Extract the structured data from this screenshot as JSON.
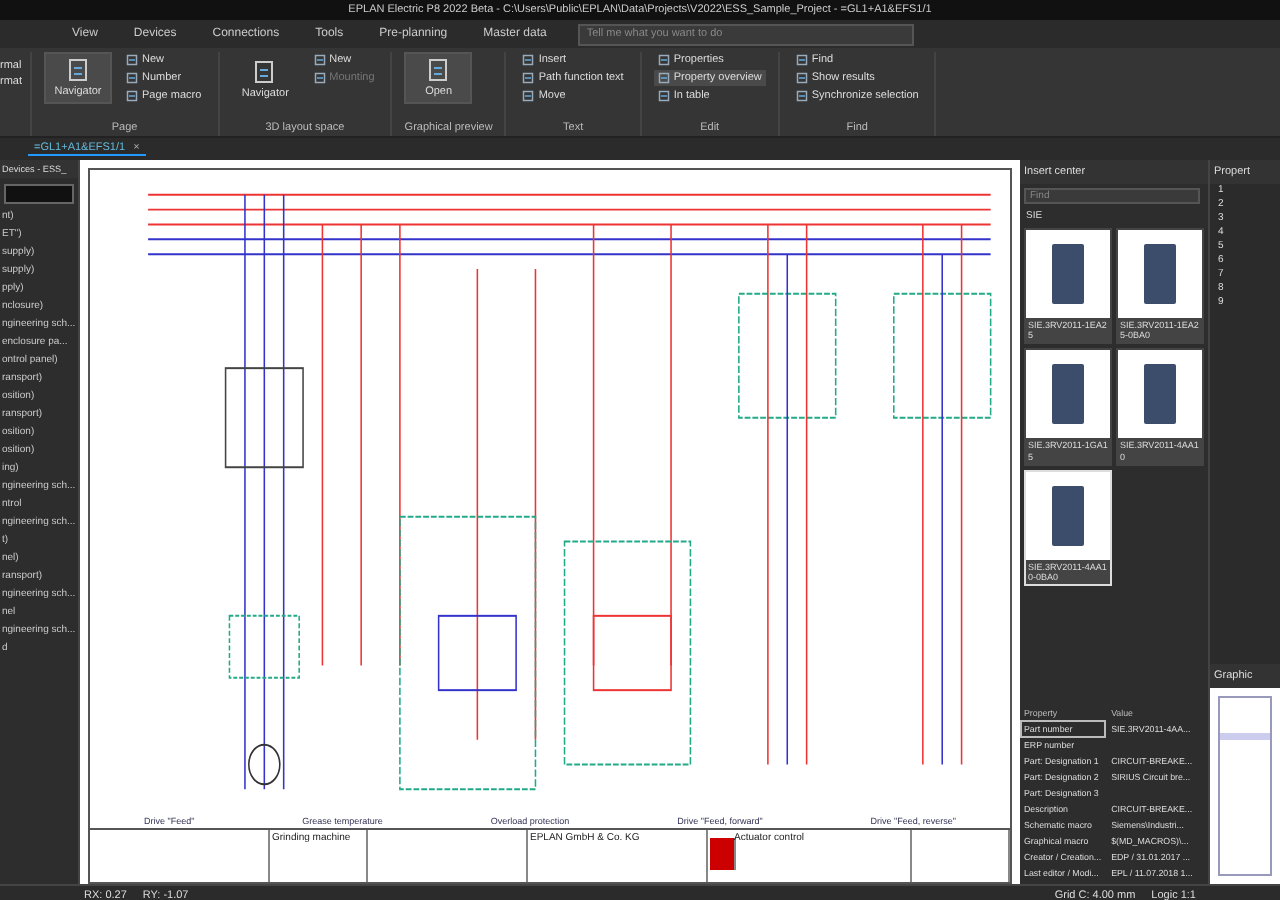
{
  "window": {
    "title": "EPLAN Electric P8 2022 Beta - C:\\Users\\Public\\EPLAN\\Data\\Projects\\V2022\\ESS_Sample_Project - =GL1+A1&EFS1/1"
  },
  "menu": [
    {
      "label": "View",
      "selected": false
    },
    {
      "label": "Devices",
      "selected": false
    },
    {
      "label": "Connections",
      "selected": false
    },
    {
      "label": "Tools",
      "selected": false
    },
    {
      "label": "Pre-planning",
      "selected": false
    },
    {
      "label": "Master data",
      "selected": false
    }
  ],
  "search": {
    "placeholder": "Tell me what you want to do"
  },
  "ribbon": {
    "cut_items": [
      "rmal",
      "rmat"
    ],
    "groups": [
      {
        "label": "Page",
        "large": {
          "label": "Navigator",
          "selected": true
        },
        "items": [
          {
            "label": "New",
            "disabled": false,
            "selected": false
          },
          {
            "label": "Number",
            "disabled": false,
            "selected": false
          },
          {
            "label": "Page macro",
            "disabled": false,
            "selected": false
          }
        ]
      },
      {
        "label": "3D layout space",
        "large": {
          "label": "Navigator",
          "selected": false
        },
        "items": [
          {
            "label": "New",
            "disabled": false,
            "selected": false
          },
          {
            "label": "Mounting",
            "disabled": true,
            "selected": false
          }
        ]
      },
      {
        "label": "Graphical preview",
        "large": {
          "label": "Open",
          "selected": true
        }
      },
      {
        "label": "Text",
        "items": [
          {
            "label": "Insert",
            "disabled": false,
            "selected": false
          },
          {
            "label": "Path function text",
            "disabled": false,
            "selected": false
          },
          {
            "label": "Move",
            "disabled": false,
            "selected": false
          }
        ]
      },
      {
        "label": "Edit",
        "items": [
          {
            "label": "Properties",
            "disabled": false,
            "selected": false
          },
          {
            "label": "Property overview",
            "disabled": false,
            "selected": true
          },
          {
            "label": "In table",
            "disabled": false,
            "selected": false
          }
        ]
      },
      {
        "label": "Find",
        "items": [
          {
            "label": "Find",
            "disabled": false,
            "selected": false
          },
          {
            "label": "Show results",
            "disabled": false,
            "selected": false
          },
          {
            "label": "Synchronize selection",
            "disabled": false,
            "selected": false
          }
        ]
      }
    ]
  },
  "document_tab": {
    "label": "=GL1+A1&EFS1/1",
    "close": "×"
  },
  "left_panel": {
    "title": "Devices - ESS_",
    "items": [
      "nt)",
      "ET\")",
      "supply)",
      "supply)",
      "pply)",
      "nclosure)",
      "ngineering sch...",
      "enclosure pa...",
      "ontrol panel)",
      "ransport)",
      "osition)",
      "ransport)",
      "osition)",
      "osition)",
      "ing)",
      "ngineering sch...",
      "ntrol",
      "ngineering sch...",
      "t)",
      "nel)",
      "ransport)",
      "ngineering sch...",
      "nel",
      "ngineering sch...",
      "d"
    ]
  },
  "diagram": {
    "captions": [
      "Drive \"Feed\"",
      "Grease temperature",
      "Overload protection",
      "Drive \"Feed, forward\"",
      "Drive \"Feed, reverse\""
    ],
    "title_block": {
      "project": "Grinding machine",
      "company": "EPLAN GmbH & Co. KG",
      "page_title": "Actuator control"
    }
  },
  "insert_center": {
    "title": "Insert center",
    "find_placeholder": "Find",
    "path": "SIE",
    "items": [
      {
        "label": "SIE.3RV2011-1EA25",
        "selected": false
      },
      {
        "label": "SIE.3RV2011-1EA25-0BA0",
        "selected": false
      },
      {
        "label": "SIE.3RV2011-1GA15",
        "selected": false
      },
      {
        "label": "SIE.3RV2011-4AA10",
        "selected": false
      },
      {
        "label": "SIE.3RV2011-4AA10-0BA0",
        "selected": true
      }
    ]
  },
  "properties": {
    "columns": [
      "Property",
      "Value"
    ],
    "rows": [
      {
        "property": "Part number",
        "value": "SIE.3RV2011-4AA...",
        "selected": true
      },
      {
        "property": "ERP number",
        "selected": false
      },
      {
        "property": "Part: Designation 1",
        "value": "CIRCUIT-BREAKE...",
        "selected": false
      },
      {
        "property": "Part: Designation 2",
        "value": "SIRIUS Circuit bre...",
        "selected": false
      },
      {
        "property": "Part: Designation 3",
        "selected": false
      },
      {
        "property": "Description",
        "value": "CIRCUIT-BREAKE...",
        "selected": false
      },
      {
        "property": "Schematic macro",
        "value": "Siemens\\Industri...",
        "selected": false
      },
      {
        "property": "Graphical macro",
        "value": "$(MD_MACROS)\\...",
        "selected": false
      },
      {
        "property": "Creator / Creation...",
        "value": "EDP / 31.01.2017 ...",
        "selected": false
      },
      {
        "property": "Last editor / Modi...",
        "value": "EPL / 11.07.2018 1...",
        "selected": false
      }
    ]
  },
  "right_panel": {
    "title": "Propert",
    "rows": [
      "1",
      "2",
      "3",
      "4",
      "5",
      "6",
      "7",
      "8",
      "9"
    ],
    "preview_title": "Graphic"
  },
  "status_bar": {
    "left": [
      "RX: 0.27",
      "RY: -1.07"
    ],
    "grid": "Grid C: 4.00 mm",
    "logic": "Logic 1:1"
  }
}
